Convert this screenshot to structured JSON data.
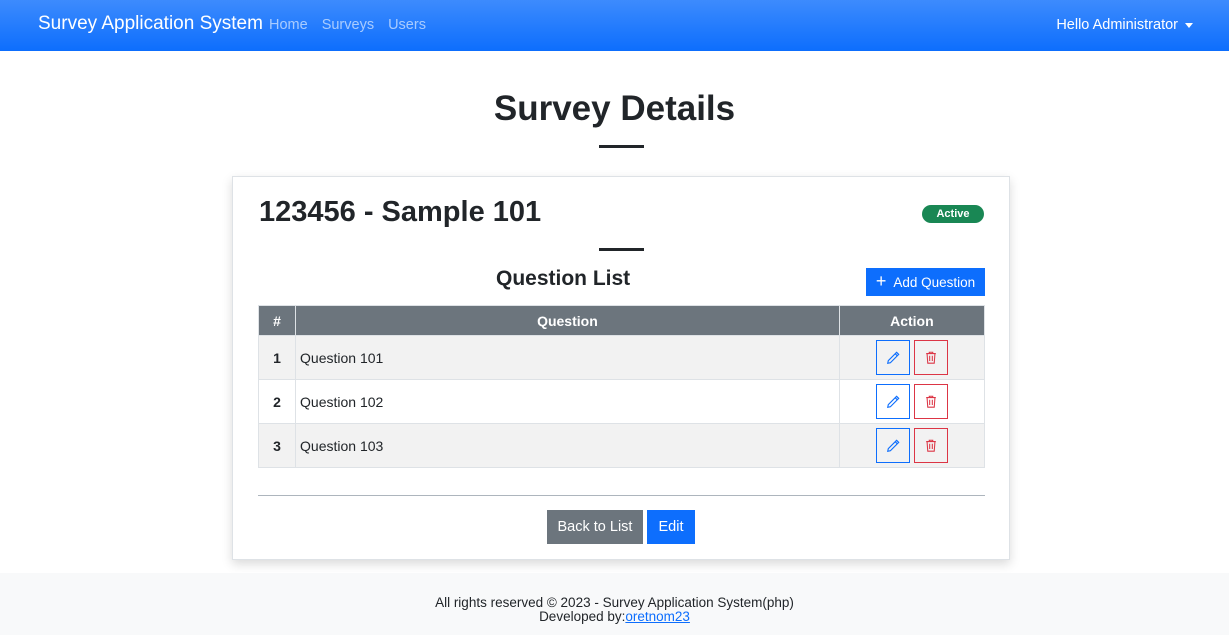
{
  "navbar": {
    "brand": "Survey Application System",
    "links": [
      "Home",
      "Surveys",
      "Users"
    ],
    "user_menu": "Hello Administrator"
  },
  "page": {
    "title": "Survey Details"
  },
  "survey": {
    "title": "123456 - Sample 101",
    "status": "Active",
    "status_color": "#198754"
  },
  "questions": {
    "heading": "Question List",
    "add_label": "Add Question",
    "columns": [
      "#",
      "Question",
      "Action"
    ],
    "rows": [
      {
        "num": "1",
        "question": "Question 101"
      },
      {
        "num": "2",
        "question": "Question 102"
      },
      {
        "num": "3",
        "question": "Question 103"
      }
    ],
    "row_actions": {
      "edit_icon": "pencil-icon",
      "delete_icon": "trash-icon"
    }
  },
  "actions": {
    "back_label": "Back to List",
    "edit_label": "Edit"
  },
  "footer": {
    "copyright": "All rights reserved © 2023 - Survey Application System(php)",
    "developed_prefix": "Developed by:",
    "developer": "oretnom23"
  },
  "colors": {
    "primary": "#0d6efd",
    "secondary": "#6c757d",
    "danger": "#dc3545",
    "success": "#198754"
  }
}
